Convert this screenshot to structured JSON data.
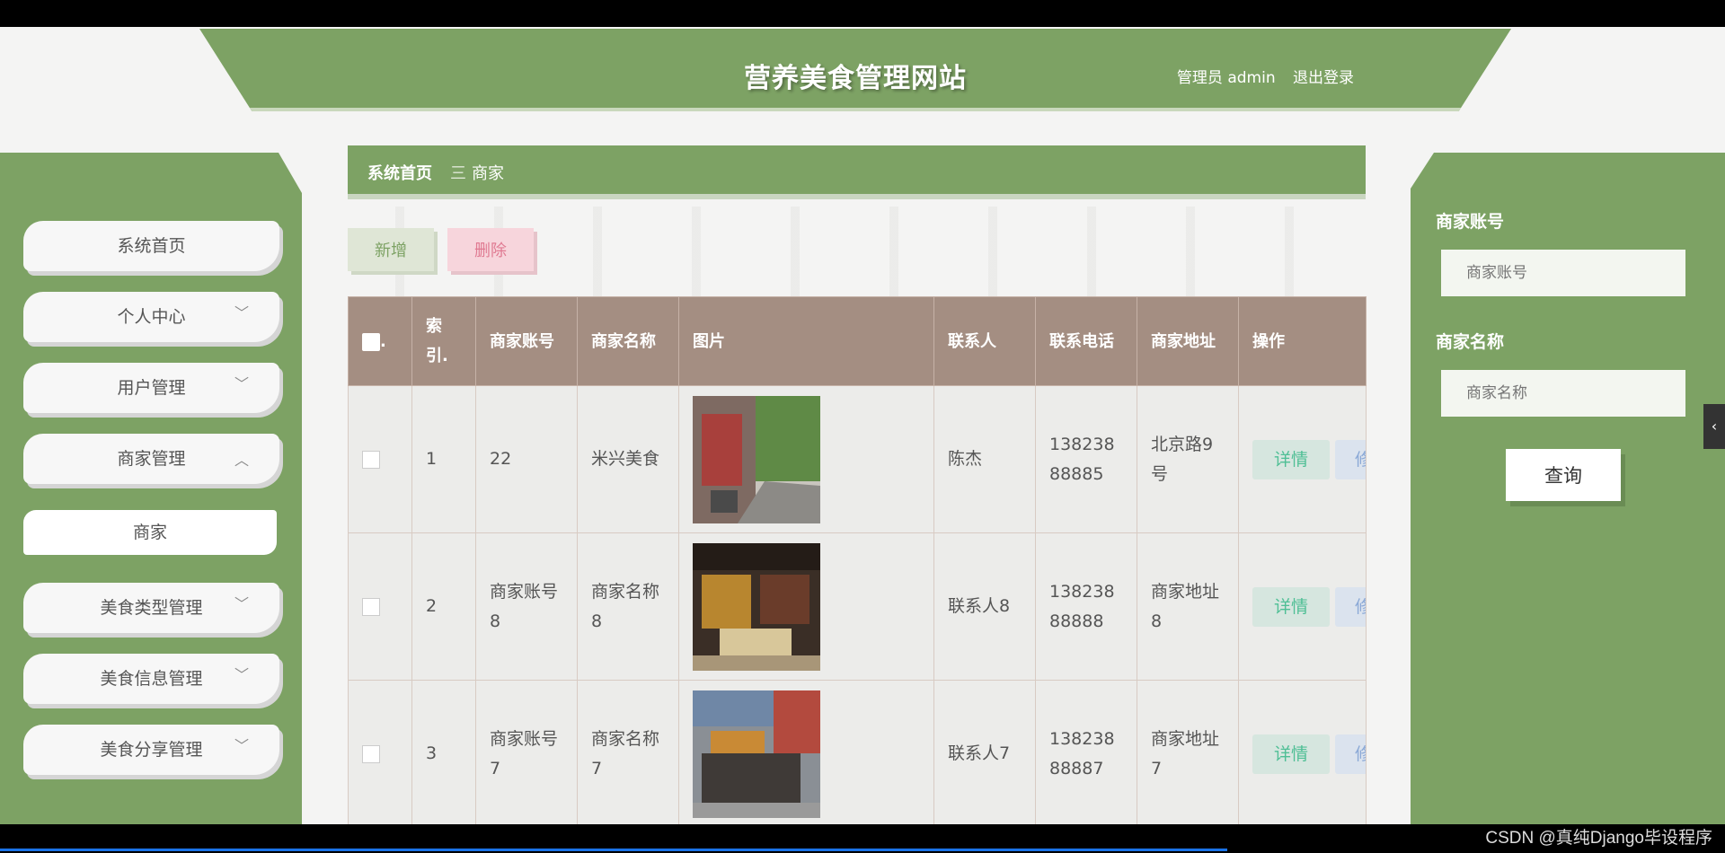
{
  "header": {
    "site_title": "营养美食管理网站",
    "user_label": "管理员 admin",
    "logout": "退出登录"
  },
  "sidebar": {
    "items": [
      {
        "label": "系统首页",
        "expandable": false
      },
      {
        "label": "个人中心",
        "expandable": true
      },
      {
        "label": "用户管理",
        "expandable": true
      },
      {
        "label": "商家管理",
        "expandable": true,
        "expanded": true
      },
      {
        "label": "美食类型管理",
        "expandable": true
      },
      {
        "label": "美食信息管理",
        "expandable": true
      },
      {
        "label": "美食分享管理",
        "expandable": true
      }
    ],
    "sub_item": "商家",
    "chevron_down": "﹀",
    "chevron_up": "︿"
  },
  "breadcrumb": {
    "home": "系统首页",
    "separator": "三",
    "current": "商家"
  },
  "toolbar": {
    "add_label": "新增",
    "delete_label": "删除"
  },
  "table": {
    "headers": {
      "check": ".",
      "index": "索引.",
      "account": "商家账号",
      "name": "商家名称",
      "image": "图片",
      "contact": "联系人",
      "phone": "联系电话",
      "address": "商家地址",
      "actions": "操作"
    },
    "rows": [
      {
        "index": "1",
        "account": "22",
        "name": "米兴美食",
        "contact": "陈杰",
        "phone": "13823888885",
        "address": "北京路9号",
        "detail": "详情"
      },
      {
        "index": "2",
        "account": "商家账号8",
        "name": "商家名称8",
        "contact": "联系人8",
        "phone": "13823888888",
        "address": "商家地址8",
        "detail": "详情"
      },
      {
        "index": "3",
        "account": "商家账号7",
        "name": "商家名称7",
        "contact": "联系人7",
        "phone": "13823888887",
        "address": "商家地址7",
        "detail": "详情"
      }
    ],
    "edit_glyph": "修"
  },
  "search": {
    "account_label": "商家账号",
    "account_placeholder": "商家账号",
    "name_label": "商家名称",
    "name_placeholder": "商家名称",
    "query_button": "查询"
  },
  "side_toggle": "‹",
  "watermark": "CSDN @真纯Django毕设程序",
  "colors": {
    "primary_green": "#7da264",
    "table_header": "#a48e82",
    "detail_text": "#4fbf95",
    "delete_text": "#e07a92"
  }
}
